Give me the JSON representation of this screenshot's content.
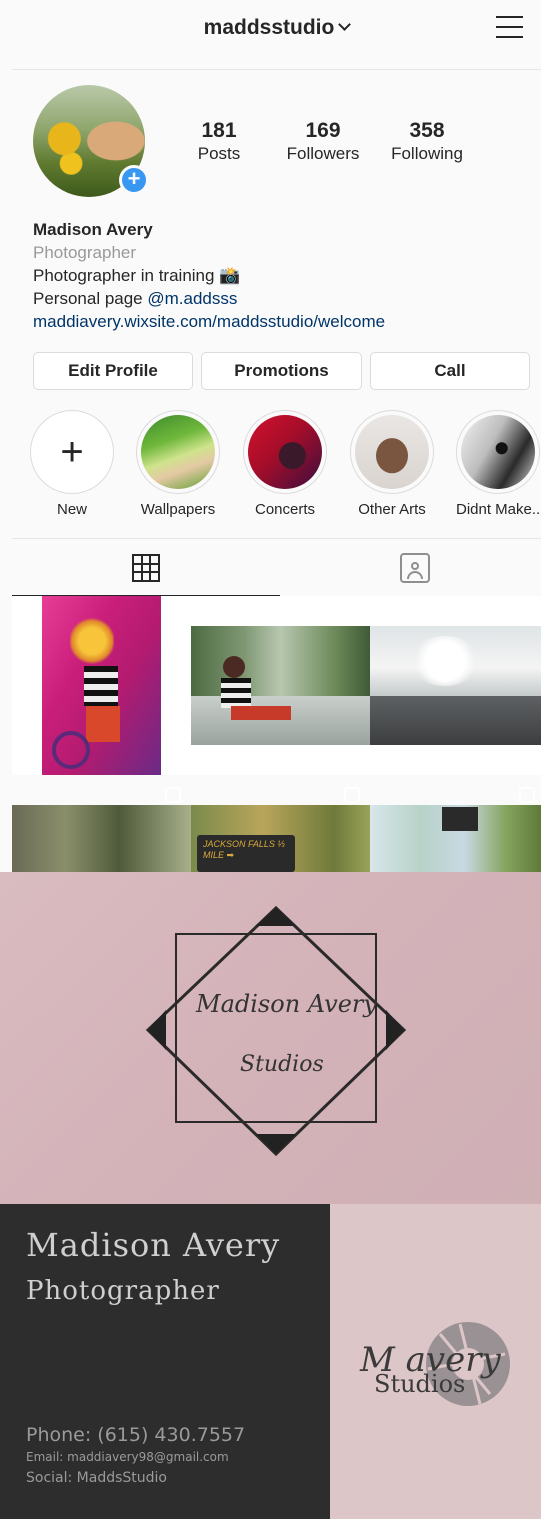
{
  "profile": {
    "username": "maddsstudio",
    "stats": [
      {
        "value": "181",
        "label": "Posts"
      },
      {
        "value": "169",
        "label": "Followers"
      },
      {
        "value": "358",
        "label": "Following"
      }
    ],
    "name": "Madison Avery",
    "category": "Photographer",
    "bio_line1": "Photographer in training 📸",
    "bio_line2_prefix": "Personal page ",
    "bio_mention": "@m.addsss",
    "website": "maddiavery.wixsite.com/maddsstudio/welcome"
  },
  "buttons": {
    "edit_profile": "Edit Profile",
    "promotions": "Promotions",
    "call": "Call"
  },
  "highlights": [
    {
      "label": "New",
      "icon": "plus-icon"
    },
    {
      "label": "Wallpapers"
    },
    {
      "label": "Concerts"
    },
    {
      "label": "Other Arts"
    },
    {
      "label": "Didnt Make..."
    }
  ],
  "tabs": {
    "grid": "grid-icon",
    "tagged": "tagged-icon"
  },
  "grid_sign": "JACKSON FALLS ⅓ MILE ➡",
  "logo_card": {
    "line1": "Madison Avery",
    "line2": "Studios"
  },
  "business_card": {
    "name": "Madison Avery",
    "title": "Photographer",
    "phone": "Phone: (615) 430.7557",
    "email": "Email: maddiavery98@gmail.com",
    "social": "Social: MaddsStudio",
    "logo_m": "M avery",
    "logo_studios": "Studios"
  },
  "colors": {
    "accent": "#3897f0",
    "link": "#003569"
  }
}
